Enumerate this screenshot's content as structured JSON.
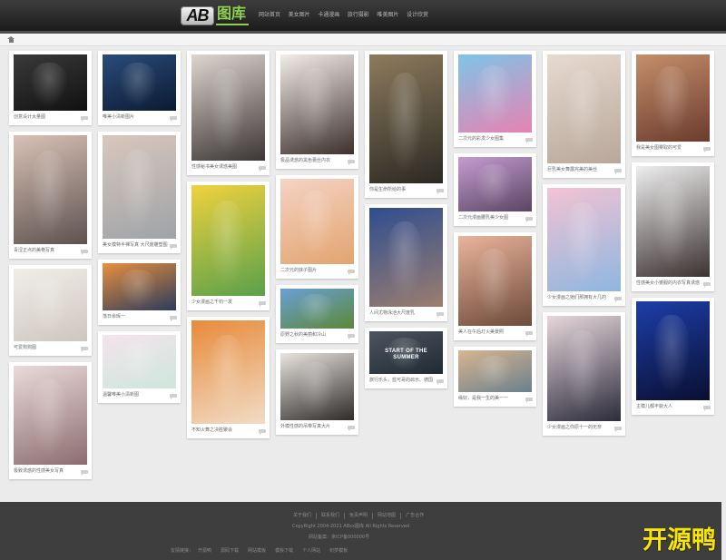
{
  "site": {
    "logo_ab": "AB",
    "logo_cn": "图库",
    "accent": "#8fd14f"
  },
  "nav": [
    {
      "label": "网站首页"
    },
    {
      "label": "美女图片"
    },
    {
      "label": "卡通漫画"
    },
    {
      "label": "旅行摄影"
    },
    {
      "label": "唯美图片"
    },
    {
      "label": "设计欣赏"
    }
  ],
  "breadcrumb": {
    "icon": "home-icon"
  },
  "columns": [
    {
      "cards": [
        {
          "caption": "创意设计大量图",
          "tone": [
            "#3a3a3a",
            "#111111"
          ]
        },
        {
          "caption": "青涩正点的美艳写真",
          "tone": [
            "#d8c2b6",
            "#5e524f"
          ]
        },
        {
          "caption": "可爱狗狗图",
          "tone": [
            "#f1eee9",
            "#cdc6bd"
          ]
        },
        {
          "caption": "极致诱惑的性感美女写真",
          "tone": [
            "#eadadb",
            "#8c6d6e"
          ]
        }
      ]
    },
    {
      "cards": [
        {
          "caption": "唯美小清新图片",
          "tone": [
            "#2a4c7a",
            "#0b1a33"
          ]
        },
        {
          "caption": "美女模特半裸写真 大尺度雕塑图",
          "tone": [
            "#d9c7bc",
            "#9ea3a8"
          ]
        },
        {
          "caption": "落日余晖一",
          "tone": [
            "#e8903e",
            "#2c3b5c"
          ]
        },
        {
          "caption": "温馨唯美小清新图",
          "tone": [
            "#f4e4ec",
            "#cde6dc"
          ]
        }
      ]
    },
    {
      "cards": [
        {
          "caption": "性感秘书美女诱惑美图",
          "tone": [
            "#ddd6d0",
            "#3b3535"
          ]
        },
        {
          "caption": "少女漫画之千钧一发",
          "tone": [
            "#f0d23e",
            "#5aa04a"
          ]
        },
        {
          "caption": "不知火舞之决胜聚会",
          "tone": [
            "#e88a3a",
            "#f1dcc6"
          ]
        }
      ]
    },
    {
      "cards": [
        {
          "caption": "极品诱惑的黑色蕾丝内衣",
          "tone": [
            "#f2ede9",
            "#3d302d"
          ]
        },
        {
          "caption": "二次元的妹子图片",
          "tone": [
            "#f5d3c5",
            "#e2a46e"
          ]
        },
        {
          "caption": "原野之秋的美丽和冷山",
          "tone": [
            "#6a9fd6",
            "#5c8838"
          ]
        },
        {
          "caption": "外模性感的吊带写真大片",
          "tone": [
            "#e8e4e0",
            "#2f2b29"
          ]
        }
      ]
    },
    {
      "cards": [
        {
          "caption": "你是生命所给的事",
          "tone": [
            "#8d7b5d",
            "#2b2923"
          ]
        },
        {
          "caption": "人间尤物泳池大尺度乳",
          "tone": [
            "#2f4d90",
            "#9c7e6f"
          ]
        },
        {
          "caption": "旅行乐头，蓝可哥的启示、德国",
          "tone": [
            "#4d5560",
            "#1f2a33"
          ],
          "image_text": "START OF THE SUMMER"
        }
      ]
    },
    {
      "cards": [
        {
          "caption": "二次元的彩发少女图集",
          "tone": [
            "#7fc4e8",
            "#e683b2"
          ]
        },
        {
          "caption": "二次元漫画腰乳美少女图",
          "tone": [
            "#c59cd2",
            "#5a4562"
          ]
        },
        {
          "caption": "美人在午后灯火美景照",
          "tone": [
            "#eab49b",
            "#6c4a3a"
          ]
        },
        {
          "caption": "缘好，是我一生的美一一",
          "tone": [
            "#d8b590",
            "#6b808d"
          ]
        }
      ]
    },
    {
      "cards": [
        {
          "caption": "巨乳美女舞露完美的美丝",
          "tone": [
            "#e7dad0",
            "#b8a79a"
          ]
        },
        {
          "caption": "少女漫画之她们那拥有大几的",
          "tone": [
            "#f3c3d3",
            "#8eb6e0"
          ]
        },
        {
          "caption": "少女漫画之你原十一的无奈",
          "tone": [
            "#e7d7db",
            "#2c2c3c"
          ]
        }
      ]
    },
    {
      "cards": [
        {
          "caption": "我是美女图雾取的可爱",
          "tone": [
            "#c58f6b",
            "#6b3b2d"
          ]
        },
        {
          "caption": "性感美女小婆服的内衣写真诱惑",
          "tone": [
            "#eeeeee",
            "#3b3131"
          ]
        },
        {
          "caption": "主模儿都丰貌大人",
          "tone": [
            "#1d3ea9",
            "#0a0f31"
          ]
        }
      ]
    }
  ],
  "footer": {
    "links": [
      "关于我们",
      "联系我们",
      "免责声明",
      "网站地图",
      "广告合作"
    ],
    "copyright": "CopyRight 2004-2021 ABxx图库 All Rights Reserved",
    "icp": "网站备案：京ICP备000000号",
    "friends_label": "友情链接：",
    "friends": [
      "开源鸭",
      "源码下载",
      "网站模板",
      "模板下载",
      "个人网站",
      "织梦模板"
    ]
  },
  "watermark": "开源鸭"
}
